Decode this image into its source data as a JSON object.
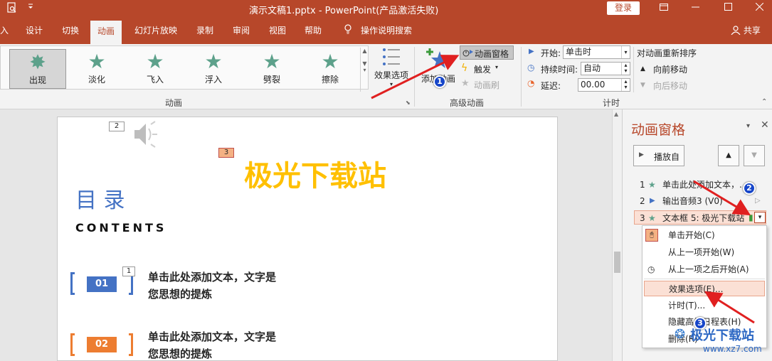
{
  "titlebar": {
    "title": "演示文稿1.pptx  -  PowerPoint(产品激活失败)",
    "login": "登录",
    "qa_icons": [
      "print-preview-icon",
      "dropdown-icon"
    ],
    "window_buttons": [
      "ribbon-display-icon",
      "minimize-icon",
      "restore-icon",
      "close-icon"
    ]
  },
  "tabs": [
    "入",
    "设计",
    "切换",
    "动画",
    "幻灯片放映",
    "录制",
    "审阅",
    "视图",
    "帮助",
    "操作说明搜索"
  ],
  "active_tab": "动画",
  "share": "共享",
  "ribbon": {
    "gallery": [
      "出现",
      "淡化",
      "飞入",
      "浮入",
      "劈裂",
      "擦除"
    ],
    "effect_options": "效果选项",
    "group_animation": "动画",
    "add_animation": "添加动画",
    "animation_pane": "动画窗格",
    "trigger": "触发",
    "anim_painter": "动画刷",
    "group_advanced": "高级动画",
    "start_label": "开始:",
    "start_value": "单击时",
    "duration_label": "持续时间:",
    "duration_value": "自动",
    "delay_label": "延迟:",
    "delay_value": "00.00",
    "group_timing": "计时",
    "reorder_title": "对动画重新排序",
    "move_earlier": "向前移动",
    "move_later": "向后移动"
  },
  "slide": {
    "tag2": "2",
    "tag3": "3",
    "tag1": "1",
    "brand": "极光下载站",
    "heading": "目  录",
    "contents": "CONTENTS",
    "item1_num": "01",
    "item1_line1": "单击此处添加文本，文字是",
    "item1_line2": "您思想的提炼",
    "item2_num": "02",
    "item2_line1": "单击此处添加文本，文字是",
    "item2_line2": "您思想的提炼"
  },
  "pane": {
    "title": "动画窗格",
    "play": "播放自",
    "items": [
      {
        "num": "1",
        "text": "单击此处添加文本，..."
      },
      {
        "num": "2",
        "text": "输出音频3 (V0)"
      },
      {
        "num": "3",
        "text": "文本框 5: 极光下载站"
      }
    ]
  },
  "menu": {
    "items": [
      "单击开始(C)",
      "从上一项开始(W)",
      "从上一项之后开始(A)",
      "效果选项(E)...",
      "计时(T)...",
      "隐藏高级日程表(H)",
      "删除(R)"
    ]
  },
  "badges": [
    "1",
    "2",
    "3"
  ],
  "watermark": {
    "name": "极光下载站",
    "url": "www.xz7.com"
  },
  "colors": {
    "accent": "#b7472a",
    "blue": "#4472c4",
    "orange": "#ed7d31",
    "brand_yellow": "#ffc000",
    "annotation_red": "#e02020"
  }
}
